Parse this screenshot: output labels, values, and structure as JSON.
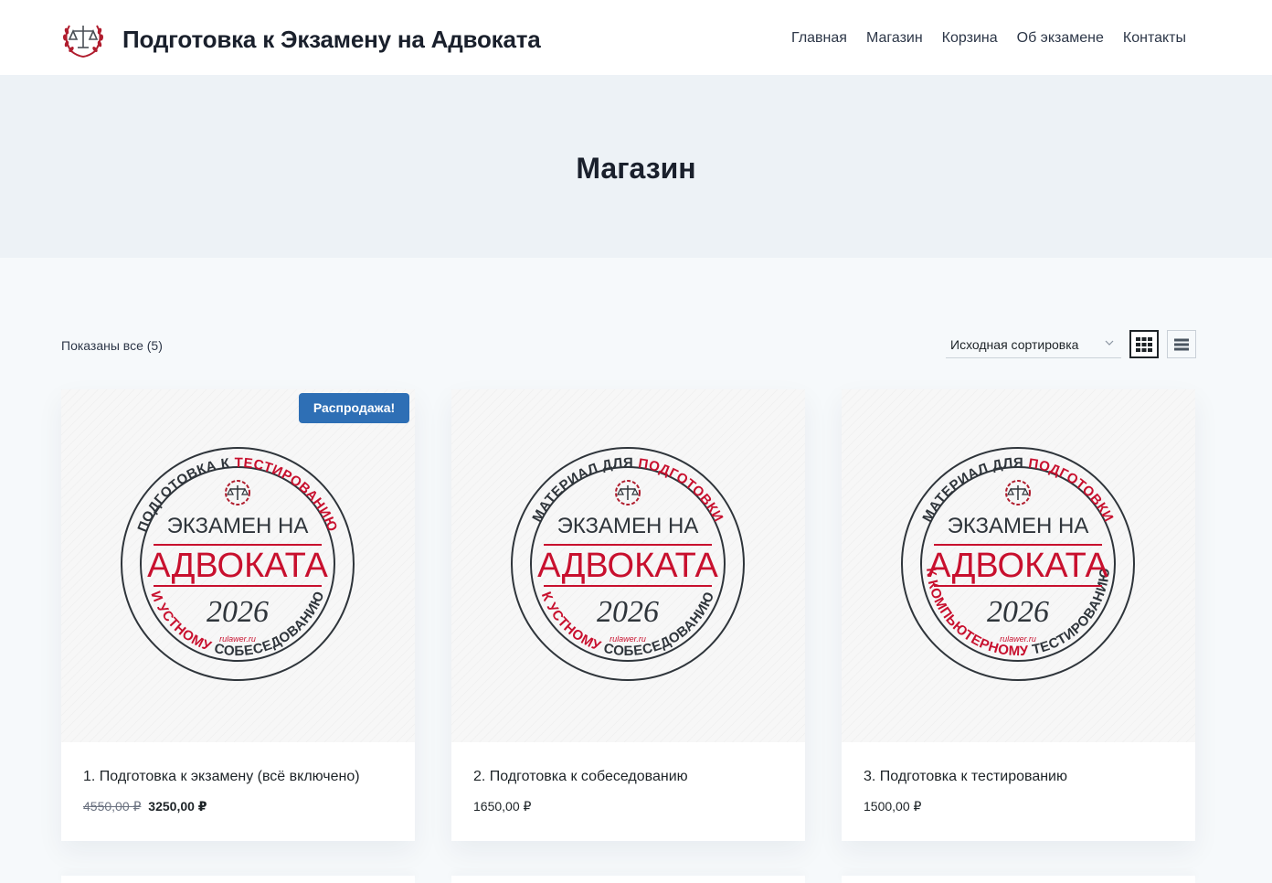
{
  "header": {
    "site_title": "Подготовка к Экзамену на Адвоката",
    "nav": [
      "Главная",
      "Магазин",
      "Корзина",
      "Об экзамене",
      "Контакты"
    ]
  },
  "hero": {
    "title": "Магазин"
  },
  "toolbar": {
    "result_count": "Показаны все (5)",
    "sort_selected": "Исходная сортировка"
  },
  "products": [
    {
      "title": "1. Подготовка к экзамену (всё включено)",
      "old_price": "4550,00 ₽",
      "price": "3250,00 ₽",
      "badge": "Распродажа!",
      "seal_top": "ПОДГОТОВКА К ТЕСТИРОВАНИЮ",
      "seal_bottom": "И УСТНОМУ СОБЕСЕДОВАНИЮ"
    },
    {
      "title": "2. Подготовка к собеседованию",
      "price": "1650,00 ₽",
      "seal_top": "МАТЕРИАЛ ДЛЯ ПОДГОТОВКИ",
      "seal_bottom": "К УСТНОМУ СОБЕСЕДОВАНИЮ"
    },
    {
      "title": "3. Подготовка к тестированию",
      "price": "1500,00 ₽",
      "seal_top": "МАТЕРИАЛ ДЛЯ ПОДГОТОВКИ",
      "seal_bottom": "К КОМПЬЮТЕРНОМУ ТЕСТИРОВАНИЮ"
    }
  ],
  "seal": {
    "line1": "ЭКЗАМЕН НА",
    "line2": "АДВОКАТА",
    "year": "2026",
    "site": "rulawer.ru"
  },
  "colors": {
    "accent_red": "#c8102e",
    "badge_blue": "#2e6fb5",
    "hero_bg": "#edf2f6"
  },
  "icons": {
    "logo": "scales-laurel-icon",
    "grid_view": "grid-icon",
    "list_view": "list-icon",
    "sort": "chevron-down-icon"
  }
}
